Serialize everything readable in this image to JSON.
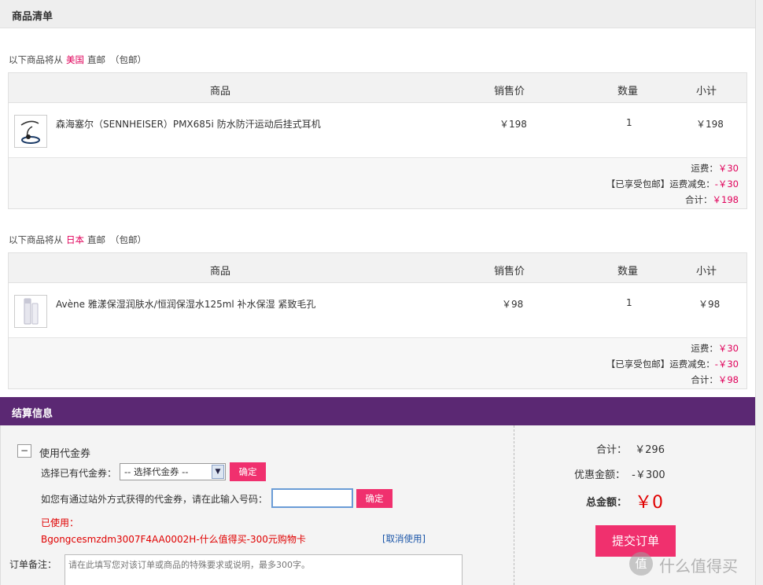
{
  "goods_section": {
    "title": "商品清单"
  },
  "shipments": [
    {
      "ship_prefix": "以下商品将从",
      "country": "美国",
      "ship_mode": "直邮",
      "ship_note": "（包邮）",
      "headers": {
        "product": "商品",
        "price": "销售价",
        "qty": "数量",
        "subtotal": "小计"
      },
      "item": {
        "name": "森海塞尔（SENNHEISER）PMX685i 防水防汗运动后挂式耳机",
        "price": "￥198",
        "qty": "1",
        "subtotal": "￥198"
      },
      "summary": {
        "shipping_label": "运费：",
        "shipping_value": "￥30",
        "discount_label": "【已享受包邮】运费减免：",
        "discount_value": "-￥30",
        "total_label": "合计：",
        "total_value": "￥198"
      }
    },
    {
      "ship_prefix": "以下商品将从",
      "country": "日本",
      "ship_mode": "直邮",
      "ship_note": "（包邮）",
      "headers": {
        "product": "商品",
        "price": "销售价",
        "qty": "数量",
        "subtotal": "小计"
      },
      "item": {
        "name": "Avène 雅漾保湿润肤水/恒润保湿水125ml 补水保湿 紧致毛孔",
        "price": "￥98",
        "qty": "1",
        "subtotal": "￥98"
      },
      "summary": {
        "shipping_label": "运费：",
        "shipping_value": "￥30",
        "discount_label": "【已享受包邮】运费减免：",
        "discount_value": "-￥30",
        "total_label": "合计：",
        "total_value": "￥98"
      }
    }
  ],
  "checkout": {
    "title": "结算信息",
    "voucher_toggle_symbol": "−",
    "voucher_label": "使用代金券",
    "select_label": "选择已有代金券：",
    "select_value": "-- 选择代金券 --",
    "confirm_label": "确定",
    "code_label": "如您有通过站外方式获得的代金券，请在此输入号码：",
    "code_value": "",
    "used_label": "已使用：",
    "used_code": "Bgongcesmzdm3007F4AA0002H-什么值得买-300元购物卡",
    "cancel_label": "[取消使用]",
    "remark_label": "订单备注：",
    "remark_placeholder": "请在此填写您对该订单或商品的特殊要求或说明，最多300字。",
    "sum_label": "合计：",
    "sum_value": "￥296",
    "discount_label": "优惠金额：",
    "discount_value": "-￥300",
    "grand_label": "总金额：",
    "grand_value": "￥0",
    "submit_label": "提交订单"
  },
  "watermark": {
    "logo_symbol": "值",
    "text": "什么值得买"
  },
  "colors": {
    "accent_pink": "#f0306e",
    "brand_purple": "#5b2873",
    "price_pink": "#e0005a"
  }
}
